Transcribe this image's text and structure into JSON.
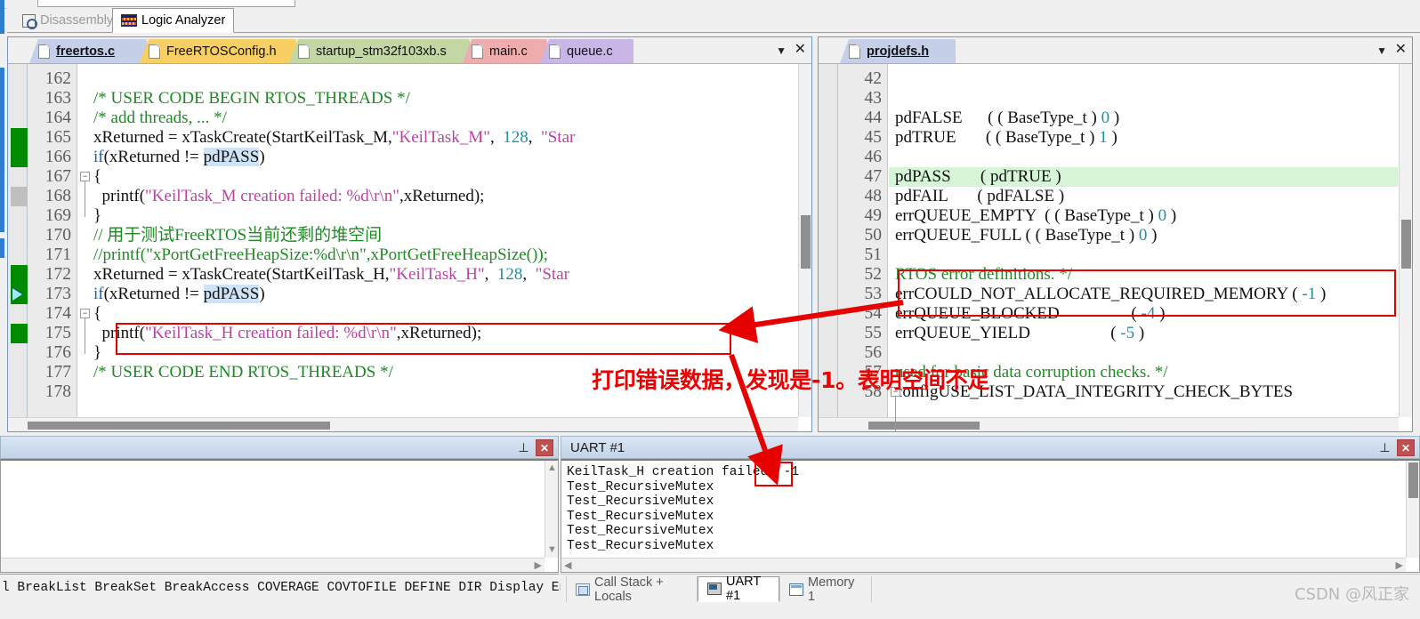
{
  "view_tabs": [
    {
      "label": "Disassembly",
      "icon": "disassembly-icon",
      "active": false
    },
    {
      "label": "Logic Analyzer",
      "icon": "logic-analyzer-icon",
      "active": true
    }
  ],
  "left_editor": {
    "tabs": [
      {
        "label": "freertos.c",
        "color": "#c5cfe8",
        "selected": true
      },
      {
        "label": "FreeRTOSConfig.h",
        "color": "#f8cf62",
        "selected": false
      },
      {
        "label": "startup_stm32f103xb.s",
        "color": "#c3d7a4",
        "selected": false
      },
      {
        "label": "main.c",
        "color": "#eeacac",
        "selected": false
      },
      {
        "label": "queue.c",
        "color": "#c7b6e6",
        "selected": false
      }
    ],
    "dropdown_glyph": "▼",
    "close_glyph": "✕",
    "first_line_number": 162,
    "lines": [
      {
        "n": 162,
        "tokens": []
      },
      {
        "n": 163,
        "tokens": [
          {
            "t": "/* USER CODE BEGIN RTOS_THREADS */",
            "c": "cmt"
          }
        ]
      },
      {
        "n": 164,
        "tokens": [
          {
            "t": "/* add threads, ... */",
            "c": "cmt"
          }
        ]
      },
      {
        "n": 165,
        "tokens": [
          {
            "t": "xReturned = xTaskCreate(StartKeilTask_M,",
            "c": "pln"
          },
          {
            "t": "\"KeilTask_M\"",
            "c": "str"
          },
          {
            "t": ",  ",
            "c": "pln"
          },
          {
            "t": "128",
            "c": "num"
          },
          {
            "t": ",  ",
            "c": "pln"
          },
          {
            "t": "\"Star",
            "c": "str"
          }
        ]
      },
      {
        "n": 166,
        "tokens": [
          {
            "t": "if",
            "c": "kw"
          },
          {
            "t": "(xReturned != ",
            "c": "pln"
          },
          {
            "t": "pdPASS",
            "c": "sel"
          },
          {
            "t": ")",
            "c": "pln"
          }
        ]
      },
      {
        "n": 167,
        "tokens": [
          {
            "t": "{",
            "c": "pln"
          }
        ]
      },
      {
        "n": 168,
        "tokens": [
          {
            "t": "  printf(",
            "c": "pln"
          },
          {
            "t": "\"KeilTask_M creation failed: %d\\r\\n\"",
            "c": "str"
          },
          {
            "t": ",xReturned);",
            "c": "pln"
          }
        ]
      },
      {
        "n": 169,
        "tokens": [
          {
            "t": "}",
            "c": "pln"
          }
        ]
      },
      {
        "n": 170,
        "tokens": [
          {
            "t": "// 用于测试FreeRTOS当前还剩的堆空间",
            "c": "cmt"
          }
        ]
      },
      {
        "n": 171,
        "tokens": [
          {
            "t": "//printf(\"xPortGetFreeHeapSize:%d\\r\\n\",xPortGetFreeHeapSize());",
            "c": "cmt"
          }
        ]
      },
      {
        "n": 172,
        "tokens": [
          {
            "t": "xReturned = xTaskCreate(StartKeilTask_H,",
            "c": "pln"
          },
          {
            "t": "\"KeilTask_H\"",
            "c": "str"
          },
          {
            "t": ",  ",
            "c": "pln"
          },
          {
            "t": "128",
            "c": "num"
          },
          {
            "t": ",  ",
            "c": "pln"
          },
          {
            "t": "\"Star",
            "c": "str"
          }
        ]
      },
      {
        "n": 173,
        "tokens": [
          {
            "t": "if",
            "c": "kw"
          },
          {
            "t": "(xReturned != ",
            "c": "pln"
          },
          {
            "t": "pdPASS",
            "c": "sel"
          },
          {
            "t": ")",
            "c": "pln"
          }
        ]
      },
      {
        "n": 174,
        "tokens": [
          {
            "t": "{",
            "c": "pln"
          }
        ]
      },
      {
        "n": 175,
        "tokens": [
          {
            "t": "  printf(",
            "c": "pln"
          },
          {
            "t": "\"KeilTask_H creation failed: %d\\r\\n\"",
            "c": "str"
          },
          {
            "t": ",xReturned);",
            "c": "pln"
          }
        ]
      },
      {
        "n": 176,
        "tokens": [
          {
            "t": "}",
            "c": "pln"
          }
        ]
      },
      {
        "n": 177,
        "tokens": [
          {
            "t": "/* USER CODE END RTOS_THREADS */",
            "c": "cmt"
          }
        ]
      },
      {
        "n": 178,
        "tokens": []
      }
    ],
    "markers": [
      {
        "line": 165,
        "type": "coverage-green",
        "span": 2
      },
      {
        "line": 168,
        "type": "coverage-gray",
        "span": 1
      },
      {
        "line": 172,
        "type": "coverage-green",
        "span": 2
      },
      {
        "line": 173,
        "type": "execution-arrow",
        "span": 0
      },
      {
        "line": 175,
        "type": "coverage-green",
        "span": 1
      }
    ],
    "fold_lines": [
      167,
      174
    ]
  },
  "right_editor": {
    "tabs": [
      {
        "label": "projdefs.h",
        "color": "#c5cfe8",
        "selected": true
      }
    ],
    "dropdown_glyph": "▼",
    "close_glyph": "✕",
    "lines": [
      {
        "n": 42,
        "tokens": []
      },
      {
        "n": 43,
        "tokens": []
      },
      {
        "n": 44,
        "tokens": [
          {
            "t": "pdFALSE      ( ( BaseType_t ) ",
            "c": "pln"
          },
          {
            "t": "0",
            "c": "num"
          },
          {
            "t": " )",
            "c": "pln"
          }
        ]
      },
      {
        "n": 45,
        "tokens": [
          {
            "t": "pdTRUE       ( ( BaseType_t ) ",
            "c": "pln"
          },
          {
            "t": "1",
            "c": "num"
          },
          {
            "t": " )",
            "c": "pln"
          }
        ]
      },
      {
        "n": 46,
        "tokens": []
      },
      {
        "n": 47,
        "tokens": [
          {
            "t": "pdPASS       ( pdTRUE )",
            "c": "pln"
          }
        ],
        "highlight": true
      },
      {
        "n": 48,
        "tokens": [
          {
            "t": "pdFAIL       ( pdFALSE )",
            "c": "pln"
          }
        ]
      },
      {
        "n": 49,
        "tokens": [
          {
            "t": "errQUEUE_EMPTY  ( ( BaseType_t ) ",
            "c": "pln"
          },
          {
            "t": "0",
            "c": "num"
          },
          {
            "t": " )",
            "c": "pln"
          }
        ]
      },
      {
        "n": 50,
        "tokens": [
          {
            "t": "errQUEUE_FULL ( ( BaseType_t ) ",
            "c": "pln"
          },
          {
            "t": "0",
            "c": "num"
          },
          {
            "t": " )",
            "c": "pln"
          }
        ]
      },
      {
        "n": 51,
        "tokens": []
      },
      {
        "n": 52,
        "tokens": [
          {
            "t": "RTOS error definitions. */",
            "c": "cmt"
          }
        ]
      },
      {
        "n": 53,
        "tokens": [
          {
            "t": "errCOULD_NOT_ALLOCATE_REQUIRED_MEMORY ( ",
            "c": "pln"
          },
          {
            "t": "-1",
            "c": "num"
          },
          {
            "t": " )",
            "c": "pln"
          }
        ]
      },
      {
        "n": 54,
        "tokens": [
          {
            "t": "errQUEUE_BLOCKED                 ( ",
            "c": "pln"
          },
          {
            "t": "-4",
            "c": "num"
          },
          {
            "t": " )",
            "c": "pln"
          }
        ]
      },
      {
        "n": 55,
        "tokens": [
          {
            "t": "errQUEUE_YIELD                   ( ",
            "c": "pln"
          },
          {
            "t": "-5",
            "c": "num"
          },
          {
            "t": " )",
            "c": "pln"
          }
        ]
      },
      {
        "n": 56,
        "tokens": []
      },
      {
        "n": 57,
        "tokens": [
          {
            "t": "used for basic data corruption checks. */",
            "c": "cmt"
          }
        ]
      },
      {
        "n": 58,
        "tokens": [
          {
            "t": "configUSE_LIST_DATA_INTEGRITY_CHECK_BYTES",
            "c": "pln"
          }
        ]
      }
    ],
    "fold_lines": [
      58
    ],
    "highlight_color": "#d6f5d6"
  },
  "bottom_left_panel": {
    "title": "",
    "pin_glyph": "⊥",
    "close_glyph": "✕",
    "content": ""
  },
  "uart_panel": {
    "title": "UART #1",
    "pin_glyph": "⊥",
    "close_glyph": "✕",
    "lines": [
      "KeilTask_H creation failed: -1",
      "Test_RecursiveMutex",
      "Test_RecursiveMutex",
      "Test_RecursiveMutex",
      "Test_RecursiveMutex",
      "Test_RecursiveMutex"
    ]
  },
  "command_bar": {
    "text": "l BreakList BreakSet BreakAccess COVERAGE COVTOFILE DEFINE DIR Display Enter"
  },
  "bottom_tabs": [
    {
      "label": "Call Stack + Locals",
      "icon": "call-stack-icon",
      "active": false
    },
    {
      "label": "UART #1",
      "icon": "uart-icon",
      "active": true
    },
    {
      "label": "Memory 1",
      "icon": "memory-icon",
      "active": false
    }
  ],
  "annotations": {
    "text": "打印错误数据，发现是-1。表明空间不足",
    "color": "#ee0000",
    "boxes": [
      {
        "name": "printf-highlight-box",
        "target": "left editor line 175"
      },
      {
        "name": "err-memory-highlight-box",
        "target": "right editor lines 52-53"
      },
      {
        "name": "uart-value-highlight-box",
        "target": "UART output -1"
      }
    ]
  },
  "watermark": "CSDN @风正家"
}
